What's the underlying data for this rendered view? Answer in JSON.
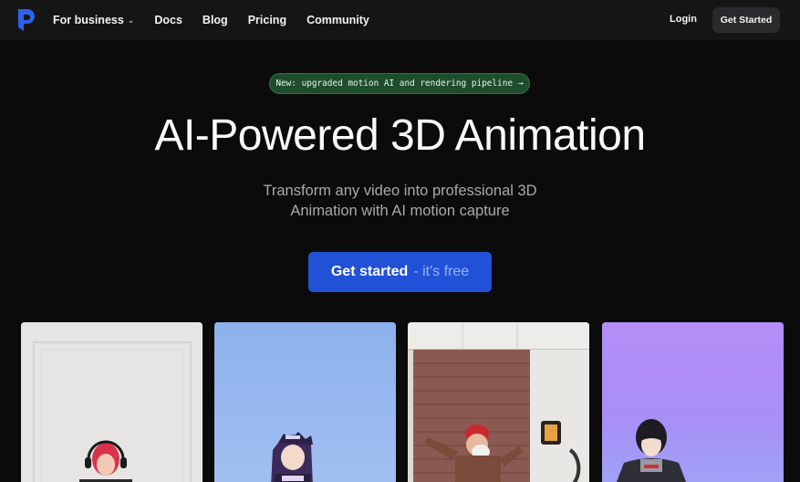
{
  "nav": {
    "links": [
      {
        "label": "For business",
        "has_dropdown": true
      },
      {
        "label": "Docs"
      },
      {
        "label": "Blog"
      },
      {
        "label": "Pricing"
      },
      {
        "label": "Community"
      }
    ],
    "login_label": "Login",
    "cta_label": "Get Started"
  },
  "hero": {
    "badge_text": "New: upgraded motion AI and rendering pipeline",
    "title": "AI-Powered 3D Animation",
    "subtitle_line1": "Transform any video into professional 3D",
    "subtitle_line2": "Animation with AI motion capture",
    "cta_main": "Get started",
    "cta_suffix": "- it's free"
  },
  "icons": {
    "logo": "brand-logo-icon",
    "dropdown": "chevron-down-icon",
    "badge_arrow": "arrow-right-icon"
  },
  "colors": {
    "background": "#0b0b0c",
    "nav_background": "#151516",
    "primary_button": "#2151d6",
    "badge_background": "#1e4d2d",
    "logo_blue": "#2b62e8"
  }
}
